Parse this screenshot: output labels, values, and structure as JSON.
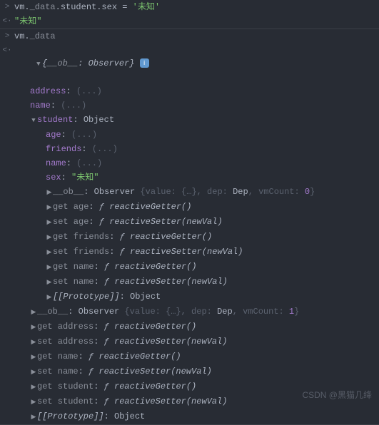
{
  "input1": {
    "prompt": ">",
    "code_parts": [
      "vm.",
      "_data",
      ".student.sex = ",
      "'未知'"
    ]
  },
  "result1": {
    "prompt": "<·",
    "value": "\"未知\""
  },
  "input2": {
    "prompt": ">",
    "code_parts": [
      "vm.",
      "_data"
    ]
  },
  "result2": {
    "prompt": "<·"
  },
  "tree": {
    "root": {
      "key": "__ob__",
      "type": "Observer"
    },
    "level1": {
      "address": {
        "label": "address",
        "value": "(...)"
      },
      "name": {
        "label": "name",
        "value": "(...)"
      },
      "student": {
        "label": "student",
        "type": "Object"
      }
    },
    "student_children": {
      "age": {
        "label": "age",
        "value": "(...)"
      },
      "friends": {
        "label": "friends",
        "value": "(...)"
      },
      "name": {
        "label": "name",
        "value": "(...)"
      },
      "sex": {
        "label": "sex",
        "value": "\"未知\""
      }
    },
    "student_ob": {
      "key": "__ob__",
      "type": "Observer",
      "detail_prefix": " {value: ",
      "detail_brace": "{…}",
      "detail_mid": ", dep: ",
      "dep": "Dep",
      "detail_vm": ", vmCount: ",
      "vmCount": "0",
      "detail_end": "}"
    },
    "student_accessors": [
      {
        "kind": "get",
        "name": "age",
        "fn": "reactiveGetter()"
      },
      {
        "kind": "set",
        "name": "age",
        "fn": "reactiveSetter(newVal)"
      },
      {
        "kind": "get",
        "name": "friends",
        "fn": "reactiveGetter()"
      },
      {
        "kind": "set",
        "name": "friends",
        "fn": "reactiveSetter(newVal)"
      },
      {
        "kind": "get",
        "name": "name",
        "fn": "reactiveGetter()"
      },
      {
        "kind": "set",
        "name": "name",
        "fn": "reactiveSetter(newVal)"
      }
    ],
    "student_proto": {
      "label": "[[Prototype]]",
      "value": "Object"
    },
    "root_ob": {
      "key": "__ob__",
      "type": "Observer",
      "detail_prefix": " {value: ",
      "detail_brace": "{…}",
      "detail_mid": ", dep: ",
      "dep": "Dep",
      "detail_vm": ", vmCount: ",
      "vmCount": "1",
      "detail_end": "}"
    },
    "root_accessors": [
      {
        "kind": "get",
        "name": "address",
        "fn": "reactiveGetter()"
      },
      {
        "kind": "set",
        "name": "address",
        "fn": "reactiveSetter(newVal)"
      },
      {
        "kind": "get",
        "name": "name",
        "fn": "reactiveGetter()"
      },
      {
        "kind": "set",
        "name": "name",
        "fn": "reactiveSetter(newVal)"
      },
      {
        "kind": "get",
        "name": "student",
        "fn": "reactiveGetter()"
      },
      {
        "kind": "set",
        "name": "student",
        "fn": "reactiveSetter(newVal)"
      }
    ],
    "root_proto": {
      "label": "[[Prototype]]",
      "value": "Object"
    }
  },
  "glyphs": {
    "f": "ƒ"
  },
  "watermark": "CSDN @黑猫几绛"
}
